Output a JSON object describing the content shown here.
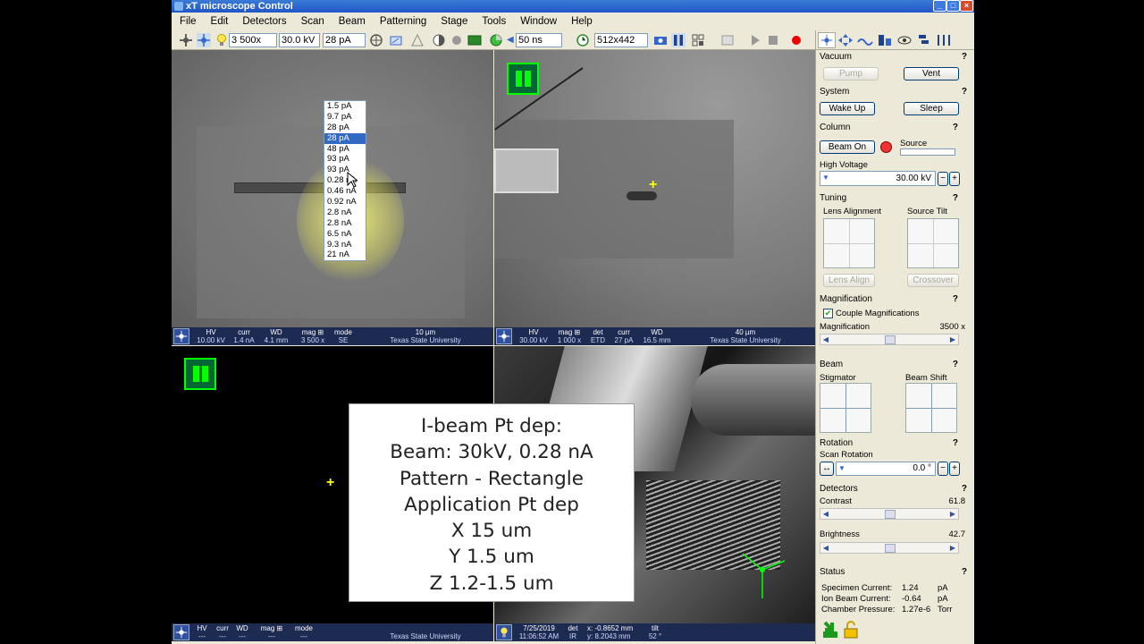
{
  "window": {
    "title": "xT microscope Control",
    "buttons": [
      "_",
      "□",
      "×"
    ]
  },
  "menu": [
    "File",
    "Edit",
    "Detectors",
    "Scan",
    "Beam",
    "Patterning",
    "Stage",
    "Tools",
    "Window",
    "Help"
  ],
  "toolbar": {
    "magnification": "3 500x",
    "voltage": "30.0 kV",
    "current": "28 pA",
    "dwell": "50 ns",
    "resolution": "512x442"
  },
  "current_dropdown": {
    "items": [
      "1.5 pA",
      "9.7 pA",
      "28 pA",
      "28 pA",
      "48 pA",
      "93 pA",
      "93 pA",
      "0.28 nA",
      "0.46 nA",
      "0.92 nA",
      "2.8 nA",
      "2.8 nA",
      "6.5 nA",
      "9.3 nA",
      "21 nA"
    ],
    "selected_index": 3
  },
  "quad1_databar": {
    "hv_label": "HV",
    "hv": "10.00 kV",
    "curr_label": "curr",
    "curr": "1.4 nA",
    "wd_label": "WD",
    "wd": "4.1 mm",
    "mag_label": "mag ⊞",
    "mag": "3 500 x",
    "mode_label": "mode",
    "mode": "SE",
    "scale": "10 µm",
    "org": "Texas State University"
  },
  "quad2_databar": {
    "hv_label": "HV",
    "hv": "30.00 kV",
    "mag_label": "mag ⊞",
    "mag": "1 000 x",
    "det_label": "det",
    "det": "ETD",
    "curr_label": "curr",
    "curr": "27 pA",
    "wd_label": "WD",
    "wd": "16.5 mm",
    "scale": "40 µm",
    "org": "Texas State University"
  },
  "quad3_databar": {
    "hv_label": "HV",
    "hv": "---",
    "curr_label": "curr",
    "curr": "---",
    "wd_label": "WD",
    "wd": "---",
    "mag_label": "mag ⊞",
    "mag": "---",
    "mode_label": "mode",
    "mode": "---",
    "org": "Texas State University"
  },
  "quad4_databar": {
    "date": "7/25/2019",
    "time": "11:06:52 AM",
    "det_label": "det",
    "det": "IR",
    "x": "x: -0.8652 mm",
    "y": "y: 8.2043 mm",
    "tilt_label": "tilt",
    "tilt": "52 °"
  },
  "caption": {
    "lines": [
      "I-beam Pt dep:",
      "Beam: 30kV, 0.28 nA",
      "Pattern - Rectangle",
      "Application Pt dep",
      "X 15 um",
      "Y 1.5 um",
      "Z 1.2-1.5 um"
    ]
  },
  "panel": {
    "vacuum": {
      "title": "Vacuum",
      "pump": "Pump",
      "vent": "Vent"
    },
    "system": {
      "title": "System",
      "wake": "Wake Up",
      "sleep": "Sleep"
    },
    "column": {
      "title": "Column",
      "beam_on": "Beam On",
      "source": "Source",
      "hv_label": "High Voltage",
      "hv": "30.00 kV"
    },
    "tuning": {
      "title": "Tuning",
      "lens_alignment": "Lens Alignment",
      "source_tilt": "Source Tilt",
      "lens_align": "Lens Align",
      "crossover": "Crossover"
    },
    "magnification": {
      "title": "Magnification",
      "couple": "Couple Magnifications",
      "label": "Magnification",
      "value": "3500 x"
    },
    "beam": {
      "title": "Beam",
      "stigmator": "Stigmator",
      "beam_shift": "Beam Shift"
    },
    "rotation": {
      "title": "Rotation",
      "label": "Scan Rotation",
      "value": "0.0 °"
    },
    "detectors": {
      "title": "Detectors",
      "contrast_label": "Contrast",
      "contrast": "61.8",
      "brightness_label": "Brightness",
      "brightness": "42.7"
    },
    "status": {
      "title": "Status",
      "specimen_label": "Specimen Current:",
      "specimen": "1.24",
      "specimen_unit": "pA",
      "ion_label": "Ion Beam Current:",
      "ion": "-0.64",
      "ion_unit": "pA",
      "chamber_label": "Chamber Pressure:",
      "chamber": "1.27e-6",
      "chamber_unit": "Torr"
    },
    "help": "?"
  },
  "colors": {
    "titlebar": "#1f56c8",
    "databar": "#1d2a52",
    "pause_green": "#00ff00",
    "highlight": "#316ac5"
  }
}
